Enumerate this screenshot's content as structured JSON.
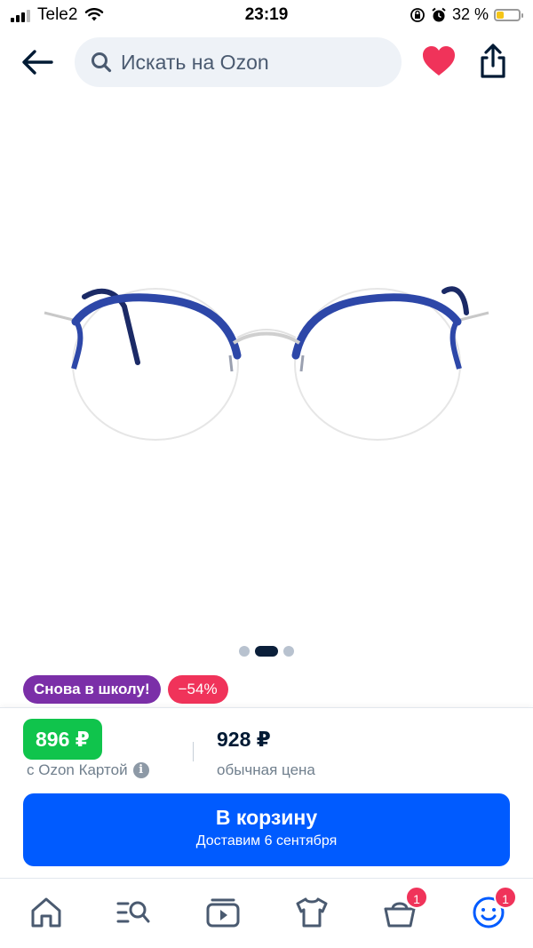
{
  "status_bar": {
    "carrier": "Tele2",
    "time": "23:19",
    "battery_percent_text": "32 %",
    "battery_level": 0.32
  },
  "header": {
    "search_placeholder": "Искать на Ozon",
    "icons": [
      "back-arrow-icon",
      "search-icon",
      "heart-icon",
      "share-icon"
    ]
  },
  "gallery": {
    "image_name": "eyeglasses-image",
    "dot_count": 3,
    "active_dot": 1
  },
  "tags": [
    {
      "label": "Снова в школу!",
      "color": "#7b2fa8"
    },
    {
      "label": "−54%",
      "color": "#f0335a"
    }
  ],
  "price": {
    "card_price": "896 ₽",
    "card_label": "с Ozon Картой",
    "regular_price": "928 ₽",
    "regular_label": "обычная цена"
  },
  "cart_button": {
    "title": "В корзину",
    "subtitle": "Доставим 6 сентября"
  },
  "bottom_nav": {
    "items": [
      {
        "name": "home",
        "badge": null
      },
      {
        "name": "catalog",
        "badge": null
      },
      {
        "name": "video",
        "badge": null
      },
      {
        "name": "fresh",
        "badge": null
      },
      {
        "name": "cart",
        "badge": "1"
      },
      {
        "name": "profile",
        "badge": "1"
      }
    ]
  },
  "colors": {
    "accent_blue": "#005bff",
    "green_price": "#10c44c",
    "heart_red": "#f0335a",
    "purple_tag": "#7b2fa8",
    "text_dark": "#001a34"
  }
}
